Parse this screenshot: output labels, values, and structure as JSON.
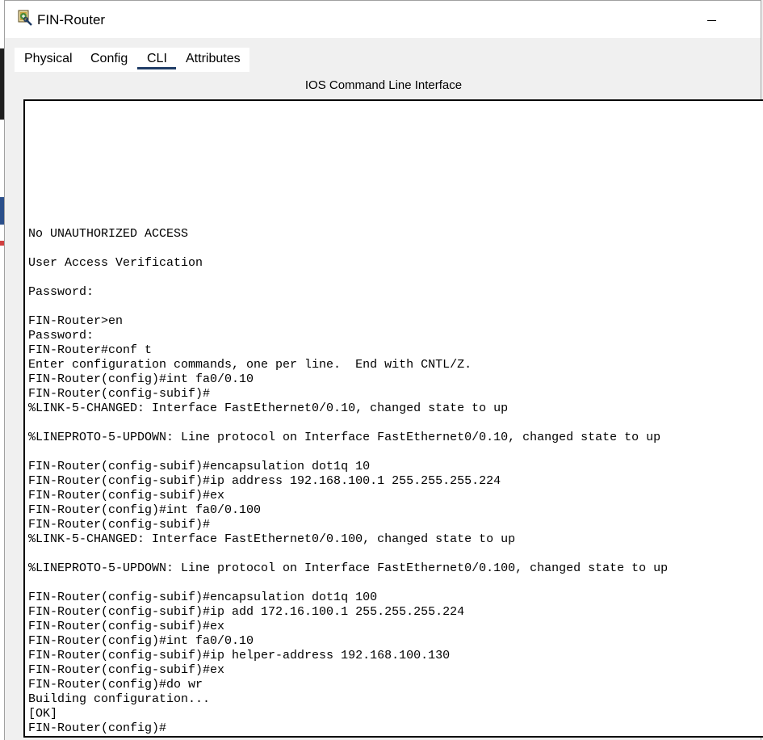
{
  "window": {
    "title": "FIN-Router"
  },
  "tabs": [
    {
      "label": "Physical",
      "active": false
    },
    {
      "label": "Config",
      "active": false
    },
    {
      "label": "CLI",
      "active": true
    },
    {
      "label": "Attributes",
      "active": false
    }
  ],
  "panel": {
    "heading": "IOS Command Line Interface"
  },
  "colors": {
    "tab_underline": "#1f3c66",
    "terminal_border": "#000000",
    "terminal_background": "#ffffff"
  },
  "icons": {
    "app": "packet-tracer-router-icon",
    "minimize": "minimize-icon"
  },
  "terminal": {
    "lines": [
      "No UNAUTHORIZED ACCESS",
      "",
      "User Access Verification",
      "",
      "Password:",
      "",
      "FIN-Router>en",
      "Password:",
      "FIN-Router#conf t",
      "Enter configuration commands, one per line.  End with CNTL/Z.",
      "FIN-Router(config)#int fa0/0.10",
      "FIN-Router(config-subif)#",
      "%LINK-5-CHANGED: Interface FastEthernet0/0.10, changed state to up",
      "",
      "%LINEPROTO-5-UPDOWN: Line protocol on Interface FastEthernet0/0.10, changed state to up",
      "",
      "FIN-Router(config-subif)#encapsulation dot1q 10",
      "FIN-Router(config-subif)#ip address 192.168.100.1 255.255.255.224",
      "FIN-Router(config-subif)#ex",
      "FIN-Router(config)#int fa0/0.100",
      "FIN-Router(config-subif)#",
      "%LINK-5-CHANGED: Interface FastEthernet0/0.100, changed state to up",
      "",
      "%LINEPROTO-5-UPDOWN: Line protocol on Interface FastEthernet0/0.100, changed state to up",
      "",
      "FIN-Router(config-subif)#encapsulation dot1q 100",
      "FIN-Router(config-subif)#ip add 172.16.100.1 255.255.255.224",
      "FIN-Router(config-subif)#ex",
      "FIN-Router(config)#int fa0/0.10",
      "FIN-Router(config-subif)#ip helper-address 192.168.100.130",
      "FIN-Router(config-subif)#ex",
      "FIN-Router(config)#do wr",
      "Building configuration...",
      "[OK]",
      "FIN-Router(config)#"
    ]
  }
}
